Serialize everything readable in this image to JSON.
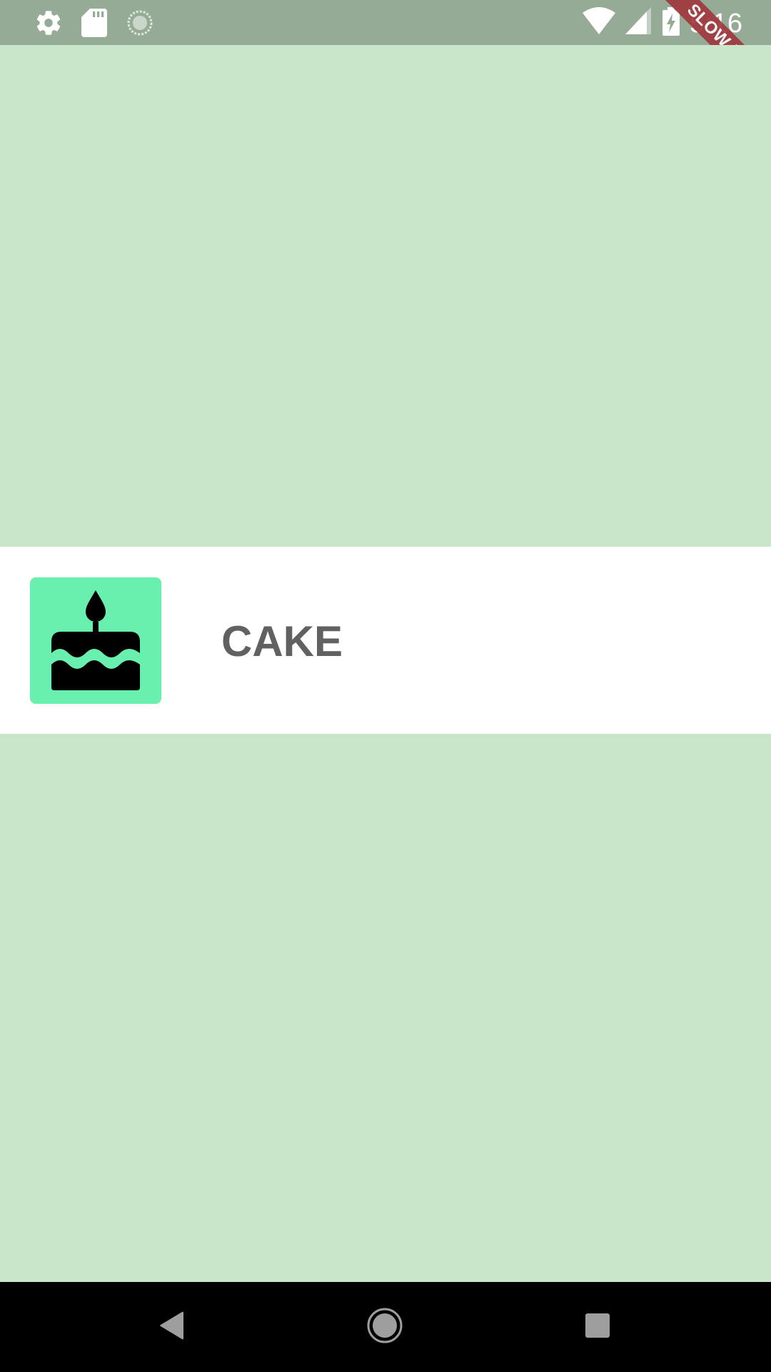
{
  "status_bar": {
    "time": "5:16",
    "left_icons": [
      "settings-icon",
      "sd-card-icon",
      "loading-icon"
    ],
    "right_icons": [
      "wifi-icon",
      "cell-signal-icon",
      "battery-charging-icon"
    ]
  },
  "debug_banner": {
    "label": "SLOW MODE",
    "color": "#a0393e"
  },
  "list_tile": {
    "icon": "cake-icon",
    "icon_background": "#69f0ae",
    "title": "CAKE"
  },
  "colors": {
    "background": "#c8e6c9",
    "status_bar": "#96ab96",
    "tile_background": "#ffffff",
    "title_text": "#616161",
    "nav_bar": "#000000"
  },
  "nav_bar": {
    "buttons": [
      "back-icon",
      "home-icon",
      "recents-icon"
    ]
  }
}
